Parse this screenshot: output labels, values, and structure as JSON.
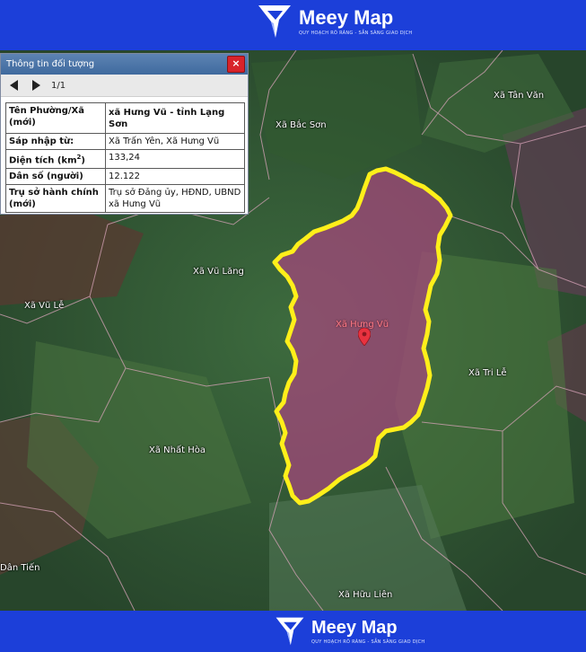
{
  "brand": {
    "name": "Meey Map",
    "tagline": "QUY HOẠCH RÕ RÀNG - SẴN SÀNG GIAO DỊCH"
  },
  "panel": {
    "title": "Thông tin đối tượng",
    "close_label": "×",
    "page": "1/1",
    "rows": [
      {
        "key": "Tên Phường/Xã (mới)",
        "value": "xã Hưng Vũ - tỉnh Lạng Sơn"
      },
      {
        "key": "Sáp nhập từ:",
        "value": "Xã Trấn Yên, Xã Hưng Vũ"
      },
      {
        "key": "Diện tích (km",
        "key_sup": "2",
        "key_end": ")",
        "value": "133,24"
      },
      {
        "key": "Dân số (người)",
        "value": "12.122"
      },
      {
        "key": "Trụ sở hành chính (mới)",
        "value": "Trụ sở Đảng ủy, HĐND, UBND xã Hưng Vũ"
      }
    ]
  },
  "map": {
    "highlight": {
      "label": "Xã Hưng Vũ",
      "fill": "#a8477e",
      "border": "#ffef1a"
    },
    "places": [
      {
        "name": "Xã Tân Văn"
      },
      {
        "name": "Xã Bắc Sơn"
      },
      {
        "name": "Xã Vũ Lăng"
      },
      {
        "name": "Xã Vũ Lễ"
      },
      {
        "name": "Xã Tri Lễ"
      },
      {
        "name": "Xã Nhất Hòa"
      },
      {
        "name": "Dân Tiến"
      },
      {
        "name": "Xã Hữu Liên"
      }
    ]
  },
  "colors": {
    "brand_blue": "#1c3fd9",
    "panel_header": "#4f78ab",
    "close_red": "#d8232a",
    "pin_red": "#e8323f"
  },
  "icons": {
    "logo": "meey-logo-icon",
    "pin": "map-pin-icon"
  }
}
